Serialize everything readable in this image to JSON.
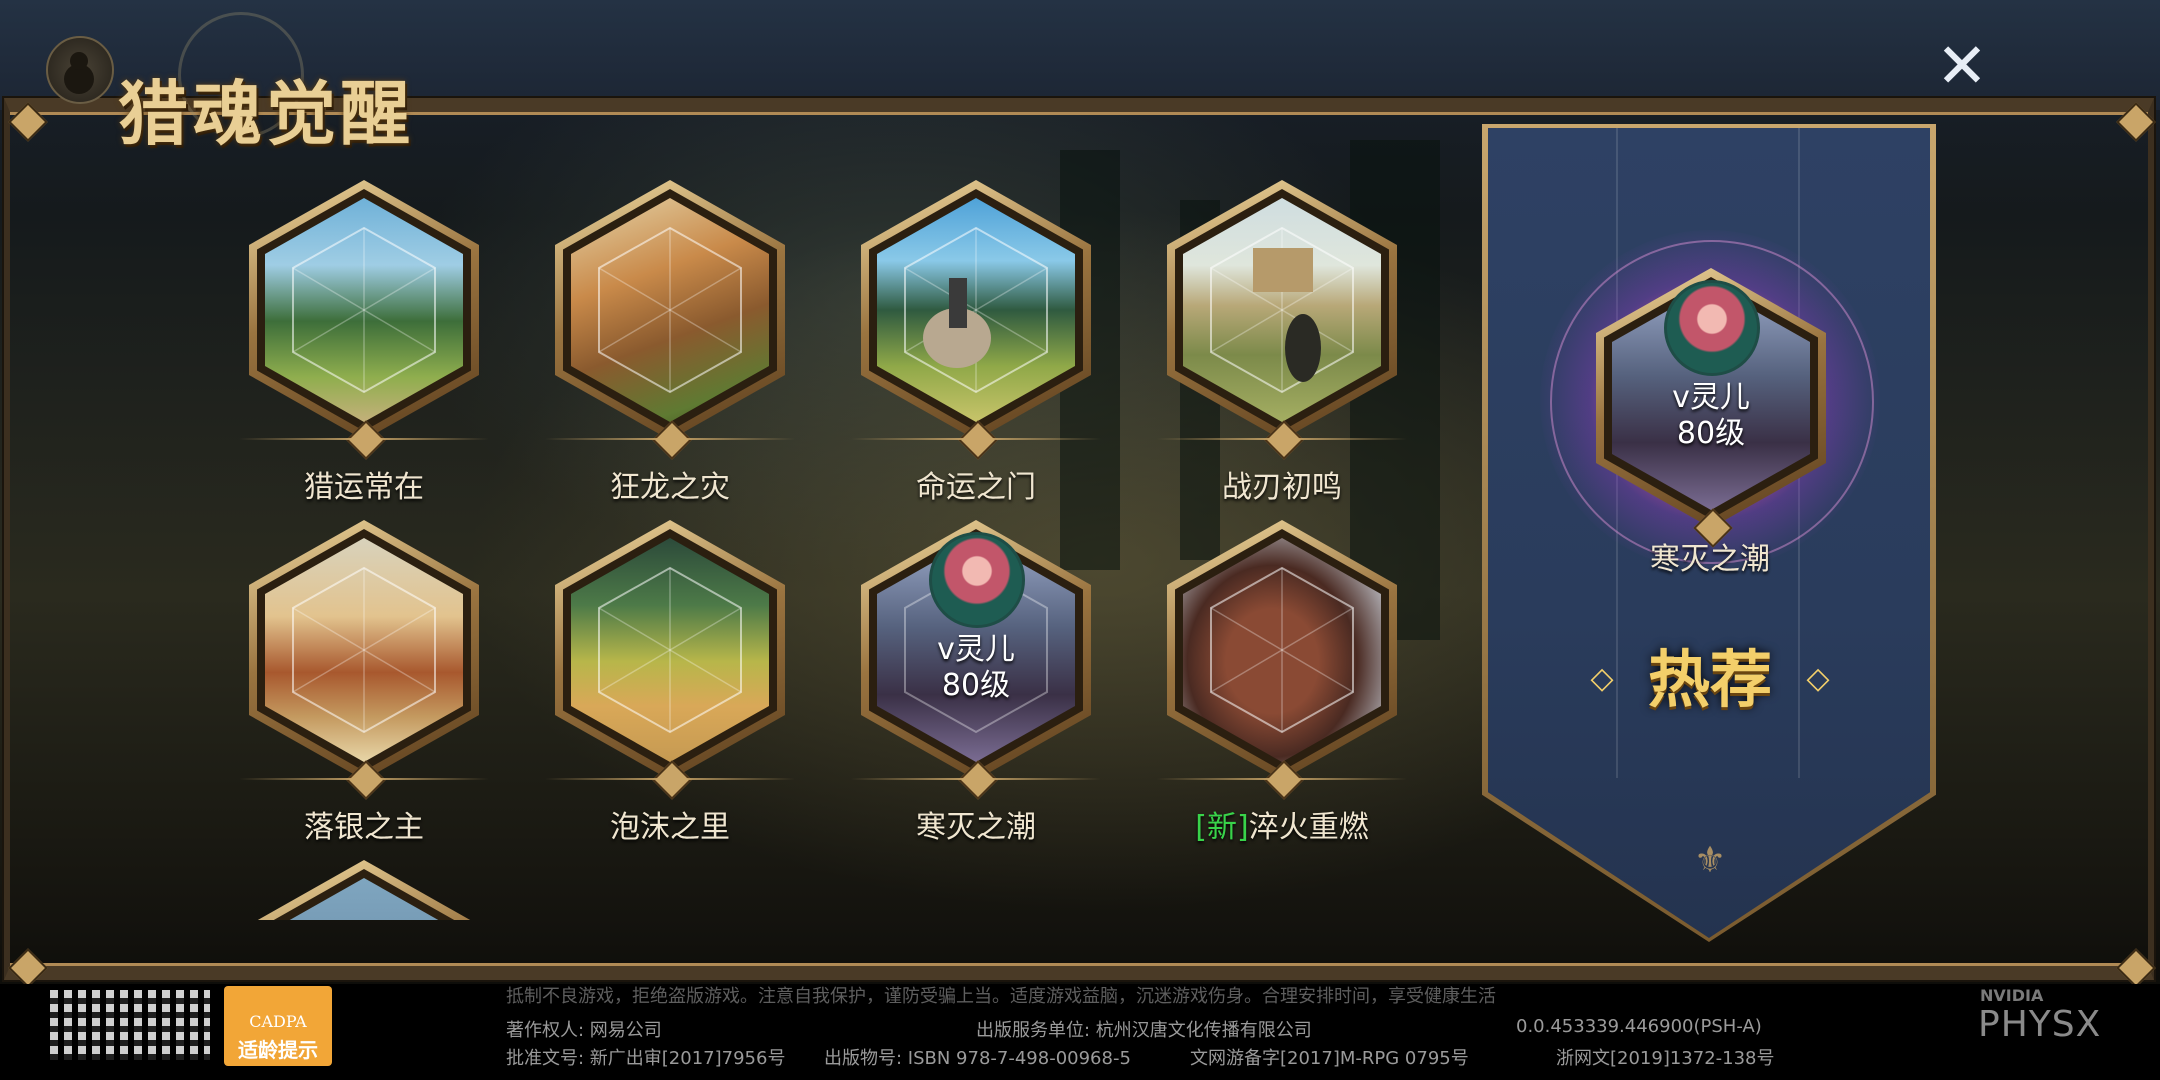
{
  "window": {
    "title": "猎魂觉醒"
  },
  "header": {
    "close_symbol": "✕"
  },
  "modes": [
    {
      "label": "猎运常在",
      "scene": "forest-castle"
    },
    {
      "label": "狂龙之灾",
      "scene": "village-house"
    },
    {
      "label": "命运之门",
      "scene": "horse-rider"
    },
    {
      "label": "战刃初鸣",
      "scene": "ruined-castle"
    },
    {
      "label": "落银之主",
      "scene": "desert-city"
    },
    {
      "label": "泡沫之里",
      "scene": "grass-field"
    },
    {
      "label": "寒灭之潮",
      "scene": "character-portrait",
      "character_name": "v灵儿",
      "character_level": "80级"
    },
    {
      "label_prefix": "[新]",
      "label": "淬火重燃",
      "scene": "dragon"
    }
  ],
  "recommend": {
    "character_name": "v灵儿",
    "character_level": "80级",
    "label": "寒灭之潮",
    "hot_text": "热荐"
  },
  "footer": {
    "health_notice": "抵制不良游戏，拒绝盗版游戏。注意自我保护，谨防受骗上当。适度游戏益脑，沉迷游戏伤身。合理安排时间，享受健康生活",
    "copyright": "著作权人: 网易公司",
    "publisher": "出版服务单位: 杭州汉唐文化传播有限公司",
    "version": "0.0.453339.446900(PSH-A)",
    "approval": "批准文号: 新广出审[2017]7956号",
    "isbn": "出版物号: ISBN 978-7-498-00968-5",
    "culture_record": "文网游备字[2017]M-RPG 0795号",
    "zhejiang": "浙网文[2019]1372-138号",
    "cadpa_logo": "CADPA",
    "cadpa_label": "适龄提示",
    "nvidia": "NVIDIA",
    "physx": "PHYSX"
  },
  "colors": {
    "gold": "#c9a568",
    "banner_blue": "#2e4164",
    "new_tag": "#39d34a",
    "hot_text": "#f3cf6a"
  }
}
